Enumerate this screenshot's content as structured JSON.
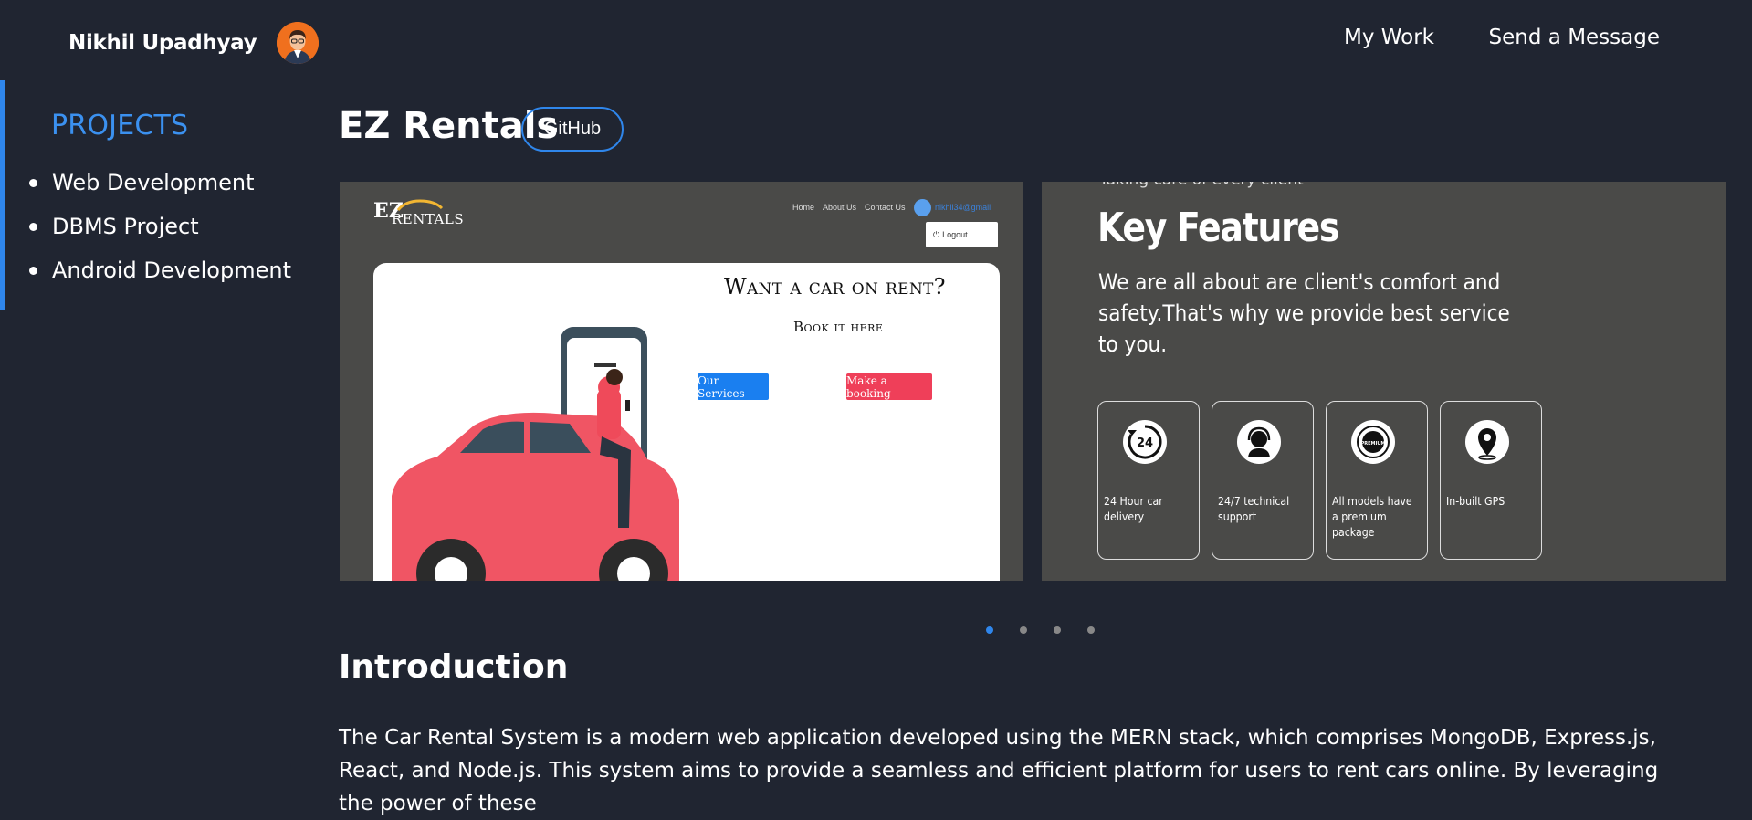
{
  "header": {
    "name": "Nikhil Upadhyay",
    "nav": [
      "My Work",
      "Send a Message"
    ]
  },
  "sidebar": {
    "title": "PROJECTS",
    "items": [
      "Web Development",
      "DBMS Project",
      "Android Development"
    ]
  },
  "project": {
    "title": "EZ Rentals",
    "github_label": "GitHub"
  },
  "slide1": {
    "logo_mark": "EZ",
    "logo_text": "RENTALS",
    "nav": [
      "Home",
      "About Us",
      "Contact Us"
    ],
    "email": "nikhil34@gmail",
    "logout": "Logout",
    "headline": "Want a car on rent?",
    "subhead": "Book it here",
    "btn_services": "Our Services",
    "btn_booking": "Make a booking"
  },
  "slide2": {
    "top_text": "Taking care of every client",
    "heading": "Key Features",
    "paragraph": "We are all about are client's comfort and safety.That's why we provide best service to you.",
    "features": [
      {
        "icon": "24",
        "label": "24 Hour car delivery"
      },
      {
        "icon": "headset",
        "label": "24/7 technical support"
      },
      {
        "icon": "premium",
        "label": "All models have a premium package"
      },
      {
        "icon": "map-pin",
        "label": "In-built GPS"
      }
    ]
  },
  "carousel": {
    "count": 4,
    "active": 0
  },
  "intro": {
    "heading": "Introduction",
    "text": "The Car Rental System is a modern web application developed using the MERN stack, which comprises MongoDB, Express.js, React, and Node.js. This system aims to provide a seamless and efficient platform for users to rent cars online. By leveraging the power of these"
  },
  "colors": {
    "background": "#202531",
    "accent": "#2f86eb",
    "slide_bg": "#4a4a48"
  }
}
